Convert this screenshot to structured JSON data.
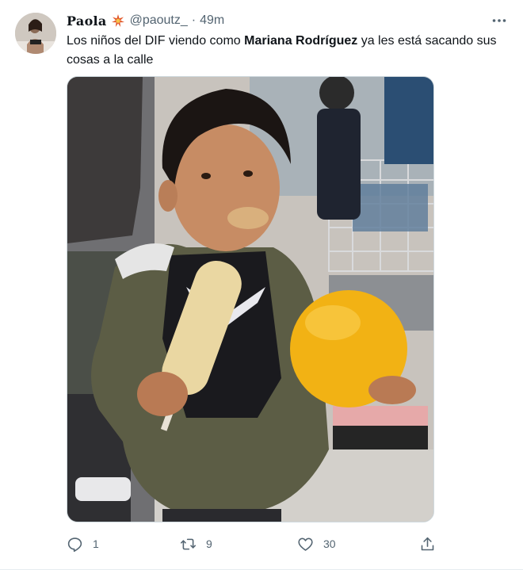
{
  "user": {
    "name": "Paola",
    "badge_icon": "sparkle-badge-icon",
    "handle": "@paoutz_",
    "separator": "·",
    "time": "49m"
  },
  "tweet": {
    "text_before": "Los niños del DIF viendo como ",
    "text_bold": "Mariana Rodríguez",
    "text_after": " ya les está sacando sus cosas a la calle"
  },
  "media": {
    "alt": "Niño con elote y pelota amarilla"
  },
  "actions": {
    "replies": "1",
    "retweets": "9",
    "likes": "30"
  },
  "colors": {
    "text": "#0f1419",
    "secondary": "#536471",
    "border": "#cfd9de"
  }
}
